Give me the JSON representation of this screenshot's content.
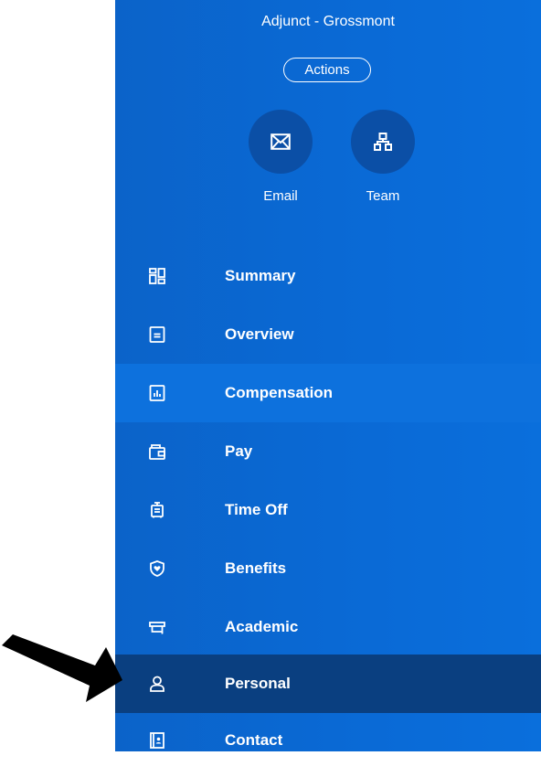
{
  "header": {
    "position_title": "Adjunct - Grossmont",
    "actions_label": "Actions"
  },
  "quick_actions": [
    {
      "label": "Email",
      "icon": "envelope-icon"
    },
    {
      "label": "Team",
      "icon": "org-chart-icon"
    }
  ],
  "nav": {
    "selected": "Personal",
    "items": [
      {
        "label": "Summary",
        "icon": "grid-icon"
      },
      {
        "label": "Overview",
        "icon": "document-icon"
      },
      {
        "label": "Compensation",
        "icon": "bar-chart-icon"
      },
      {
        "label": "Pay",
        "icon": "wallet-icon"
      },
      {
        "label": "Time Off",
        "icon": "suitcase-icon"
      },
      {
        "label": "Benefits",
        "icon": "shield-heart-icon"
      },
      {
        "label": "Academic",
        "icon": "graduation-cap-icon"
      },
      {
        "label": "Personal",
        "icon": "person-icon"
      },
      {
        "label": "Contact",
        "icon": "contact-card-icon"
      }
    ]
  },
  "annotation": {
    "pointer_icon": "black-arrow-icon",
    "points_to": "Personal"
  },
  "colors": {
    "panel": "#0b63c9",
    "highlight_row": "#0d71dd",
    "selected_row": "#0a3f80",
    "quick_circle": "#0b4fa6",
    "text": "#ffffff",
    "arrow": "#000000"
  }
}
